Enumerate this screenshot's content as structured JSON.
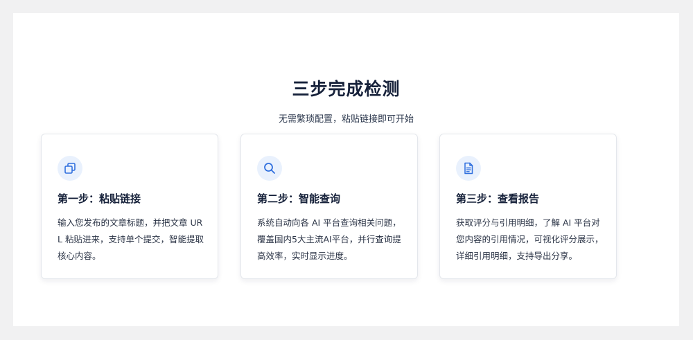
{
  "section": {
    "title": "三步完成检测",
    "subtitle": "无需繁琐配置，粘贴链接即可开始"
  },
  "colors": {
    "accent": "#2f6fde",
    "icon_bg": "#e9f1fd",
    "heading": "#16213a",
    "page_bg": "#f1f1f2"
  },
  "steps": [
    {
      "icon": "copy-icon",
      "title": "第一步：粘贴链接",
      "description": "输入您发布的文章标题，并把文章 URL 粘贴进来，支持单个提交，智能提取核心内容。"
    },
    {
      "icon": "search-icon",
      "title": "第二步：智能查询",
      "description": "系统自动向各 AI 平台查询相关问题，覆盖国内5大主流AI平台，并行查询提高效率，实时显示进度。"
    },
    {
      "icon": "document-icon",
      "title": "第三步：查看报告",
      "description": "获取评分与引用明细，了解 AI 平台对您内容的引用情况，可视化评分展示，详细引用明细，支持导出分享。"
    }
  ]
}
